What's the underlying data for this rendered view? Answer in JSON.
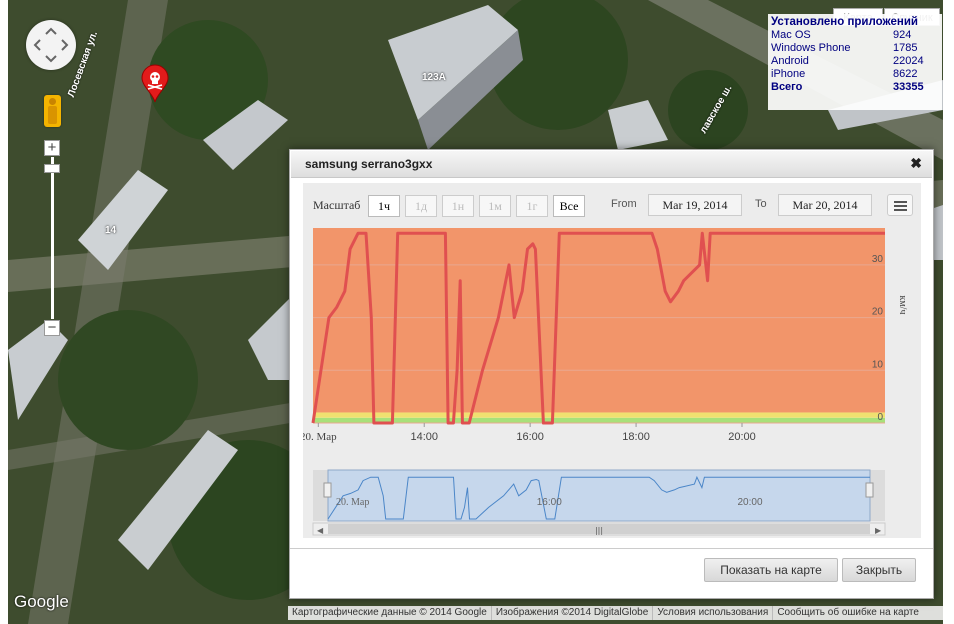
{
  "map": {
    "type_buttons": [
      "Карта",
      "Спутник"
    ],
    "street_labels": [
      "Лосевская ул.",
      "123А",
      "14",
      "лавское ш."
    ],
    "logo": "Google",
    "footer": [
      "Картографические данные © 2014 Google",
      "Изображения ©2014 DigitalGlobe",
      "Условия использования",
      "Сообщить об ошибке на карте"
    ]
  },
  "stats": {
    "title": "Установлено приложений",
    "rows": [
      {
        "name": "Mac OS",
        "value": "924"
      },
      {
        "name": "Windows Phone",
        "value": "1785"
      },
      {
        "name": "Android",
        "value": "22024"
      },
      {
        "name": "iPhone",
        "value": "8622"
      }
    ],
    "total": {
      "name": "Всего",
      "value": "33355"
    }
  },
  "dialog": {
    "title": "samsung serrano3gxx",
    "toolbar": {
      "zoom_label": "Масштаб",
      "ranges": [
        "1ч",
        "1д",
        "1н",
        "1м",
        "1г",
        "Все"
      ],
      "active_range": "1ч",
      "from_label": "From",
      "from_value": "Mar 19, 2014",
      "to_label": "To",
      "to_value": "Mar 20, 2014"
    },
    "buttons": {
      "show_on_map": "Показать на карте",
      "close": "Закрыть"
    }
  },
  "chart_data": {
    "type": "line",
    "ylabel": "км/ч",
    "ylim": [
      0,
      37
    ],
    "y_ticks": [
      0,
      10,
      20,
      30
    ],
    "x_tick_labels": [
      "20. Мар",
      "14:00",
      "16:00",
      "18:00",
      "20:00"
    ],
    "x_ticks_hours": [
      12,
      14,
      16,
      18,
      20
    ],
    "xlim_hours": [
      11.9,
      22.7
    ],
    "series": [
      {
        "color": "#e05050",
        "points": [
          [
            11.9,
            0
          ],
          [
            12.2,
            20
          ],
          [
            12.35,
            22
          ],
          [
            12.5,
            25
          ],
          [
            12.6,
            33
          ],
          [
            12.75,
            36
          ],
          [
            12.9,
            36
          ],
          [
            13.0,
            20
          ],
          [
            13.05,
            0
          ],
          [
            13.4,
            0
          ],
          [
            13.5,
            36
          ],
          [
            14.4,
            36
          ],
          [
            14.45,
            0
          ],
          [
            14.55,
            0
          ],
          [
            14.62,
            10
          ],
          [
            14.68,
            27
          ],
          [
            14.72,
            0
          ],
          [
            14.85,
            0
          ],
          [
            15.1,
            10
          ],
          [
            15.4,
            20
          ],
          [
            15.6,
            30
          ],
          [
            15.7,
            20
          ],
          [
            15.85,
            25
          ],
          [
            15.95,
            33
          ],
          [
            16.05,
            34
          ],
          [
            16.1,
            33
          ],
          [
            16.25,
            0
          ],
          [
            16.42,
            0
          ],
          [
            16.55,
            36
          ],
          [
            18.1,
            36
          ],
          [
            18.3,
            36
          ],
          [
            18.4,
            33
          ],
          [
            18.55,
            25
          ],
          [
            18.65,
            23
          ],
          [
            18.8,
            25
          ],
          [
            18.9,
            27
          ],
          [
            19.0,
            28
          ],
          [
            19.2,
            30
          ],
          [
            19.25,
            36
          ],
          [
            19.35,
            27
          ],
          [
            19.4,
            36
          ],
          [
            22.7,
            36
          ]
        ]
      }
    ],
    "navigator": {
      "x_tick_labels": [
        "20. Мар",
        "16:00",
        "20:00"
      ]
    },
    "bands": [
      {
        "from": 0,
        "to": 1,
        "color": "#a8e07a"
      },
      {
        "from": 1,
        "to": 2,
        "color": "#f0e070"
      },
      {
        "from": 2,
        "to": 37,
        "color": "#f2956a"
      }
    ]
  }
}
